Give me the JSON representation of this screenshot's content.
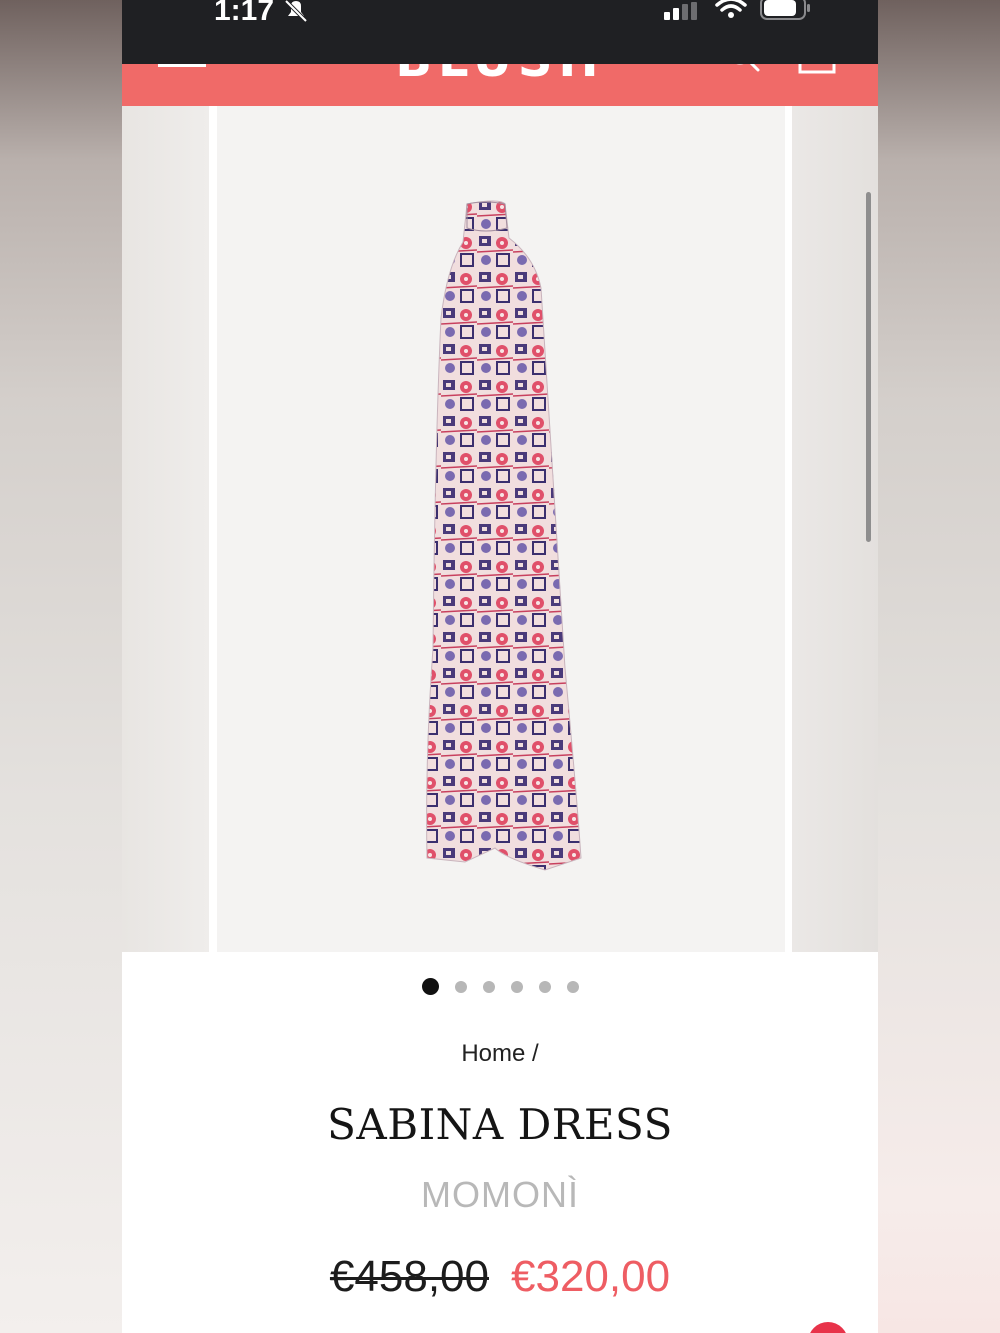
{
  "status_bar": {
    "time": "1:17"
  },
  "header": {
    "brand": "BLUSH",
    "accent_color": "#f06a68"
  },
  "icons": {
    "menu": "menu-icon",
    "search": "search-icon",
    "cart": "cart-icon",
    "zoom": "magnifier-icon"
  },
  "gallery": {
    "slide_count": 6,
    "active_slide": 1
  },
  "breadcrumb": {
    "label": "Home /"
  },
  "product": {
    "title": "SABINA DRESS",
    "brand": "MOMONÌ",
    "price_original": "€458,00",
    "price_sale": "€320,00",
    "sale_color": "#ee5d63"
  }
}
